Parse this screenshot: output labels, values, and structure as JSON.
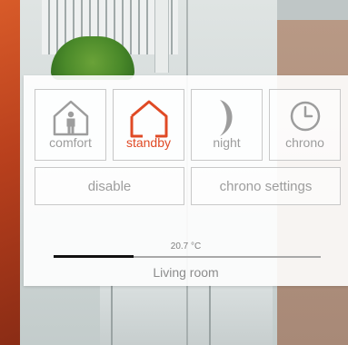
{
  "modes": {
    "comfort": {
      "label": "comfort",
      "icon": "house-person-icon"
    },
    "standby": {
      "label": "standby",
      "icon": "house-outline-icon",
      "active": true
    },
    "night": {
      "label": "night",
      "icon": "crescent-moon-icon"
    },
    "chrono": {
      "label": "chrono",
      "icon": "clock-icon"
    }
  },
  "actions": {
    "disable_label": "disable",
    "chrono_settings_label": "chrono settings"
  },
  "status": {
    "temperature": "20.7 °C",
    "room_name": "Living room",
    "slider_level": 0.3
  },
  "colors": {
    "accent": "#e04a25",
    "inactive": "#9d9d9d"
  }
}
